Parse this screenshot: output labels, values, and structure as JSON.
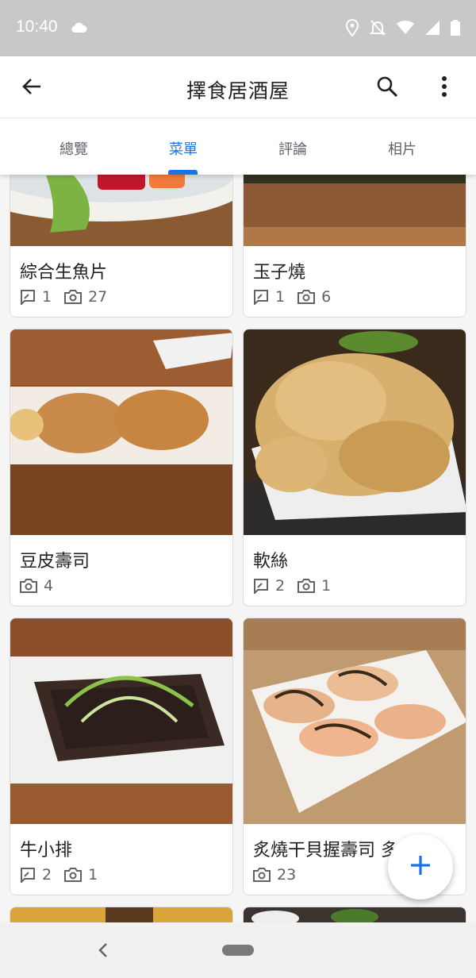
{
  "status_bar": {
    "time": "10:40",
    "icons": [
      "cloud-icon",
      "location-icon",
      "bell-off-icon",
      "wifi-icon",
      "signal-icon",
      "battery-icon"
    ]
  },
  "app_bar": {
    "title": "擇食居酒屋",
    "back_icon": "arrow-back-icon",
    "search_icon": "search-icon",
    "more_icon": "more-vert-icon"
  },
  "tabs": [
    {
      "label": "總覽",
      "active": false
    },
    {
      "label": "菜單",
      "active": true
    },
    {
      "label": "評論",
      "active": false
    },
    {
      "label": "相片",
      "active": false
    }
  ],
  "menu_items": [
    {
      "name": "綜合生魚片",
      "reviews": "1",
      "photos": "27"
    },
    {
      "name": "玉子燒",
      "reviews": "1",
      "photos": "6"
    },
    {
      "name": "豆皮壽司",
      "reviews": null,
      "photos": "4"
    },
    {
      "name": "軟絲",
      "reviews": "2",
      "photos": "1"
    },
    {
      "name": "牛小排",
      "reviews": "2",
      "photos": "1"
    },
    {
      "name": "炙燒干貝握壽司 多",
      "reviews": null,
      "photos": "23"
    }
  ],
  "fab": {
    "icon": "plus-icon"
  },
  "colors": {
    "accent": "#1a73e8",
    "status_bar": "#c8c8c8"
  }
}
